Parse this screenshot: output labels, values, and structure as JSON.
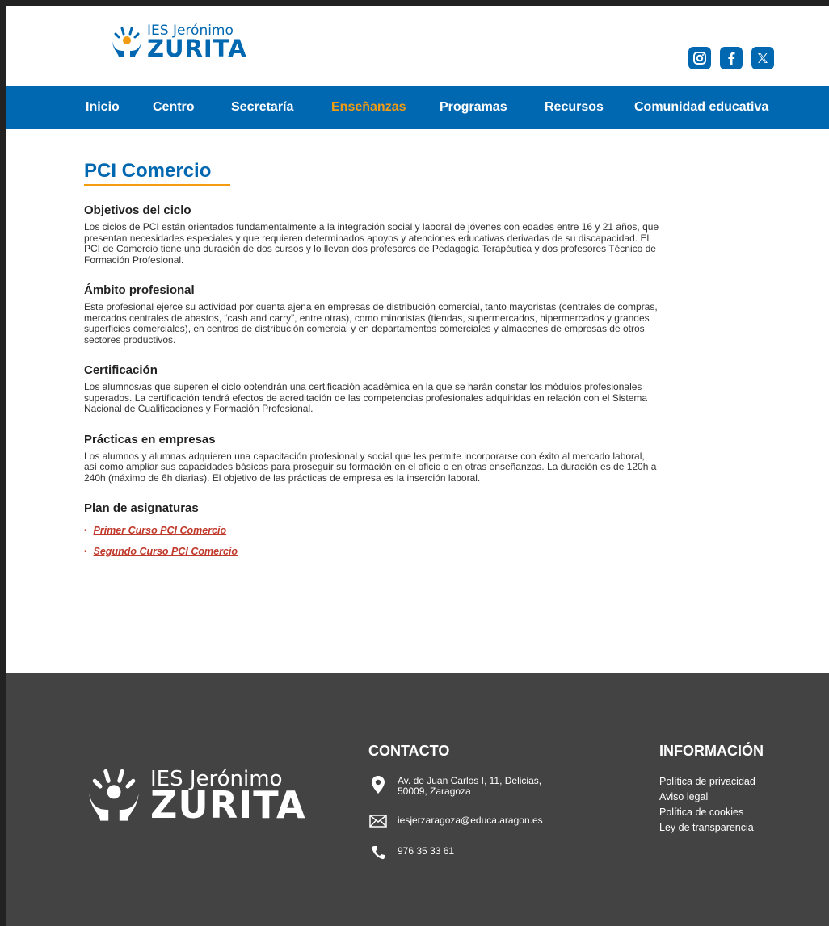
{
  "header": {
    "logo_line1": "IES Jerónimo",
    "logo_line2": "ZURITA",
    "social": [
      {
        "name": "instagram-icon"
      },
      {
        "name": "facebook-icon"
      },
      {
        "name": "x-twitter-icon"
      }
    ]
  },
  "nav": {
    "items": [
      {
        "label": "Inicio",
        "active": false
      },
      {
        "label": "Centro",
        "active": false
      },
      {
        "label": "Secretaría",
        "active": false
      },
      {
        "label": "Enseñanzas",
        "active": true
      },
      {
        "label": "Programas",
        "active": false
      },
      {
        "label": "Recursos",
        "active": false
      },
      {
        "label": "Comunidad educativa",
        "active": false
      }
    ]
  },
  "main": {
    "title": "PCI Comercio",
    "sections": [
      {
        "heading": "Objetivos del ciclo",
        "text": "Los ciclos de PCI están orientados fundamentalmente a la integración social y laboral de jóvenes con edades entre 16 y 21 años, que presentan necesidades especiales y que requieren determinados apoyos y atenciones educativas derivadas de su discapacidad. El PCI de Comercio tiene una duración de dos cursos y lo llevan dos profesores de Pedagogía Terapéutica y dos profesores Técnico de Formación Profesional."
      },
      {
        "heading": "Ámbito profesional",
        "text": "Este profesional ejerce su actividad por cuenta ajena en empresas de distribución comercial, tanto mayoristas (centrales de compras, mercados centrales de abastos, “cash and carry”, entre otras), como minoristas (tiendas, supermercados, hipermercados y grandes superficies comerciales), en centros de distribución comercial y en departamentos comerciales y almacenes de empresas de otros sectores productivos."
      },
      {
        "heading": "Certificación",
        "text": "Los alumnos/as que superen el ciclo obtendrán una certificación académica en la que se harán constar los módulos profesionales superados. La certificación tendrá efectos de acreditación de las competencias profesionales adquiridas en relación con el Sistema Nacional de Cualificaciones y Formación Profesional."
      },
      {
        "heading": "Prácticas en empresas",
        "text": "Los alumnos y alumnas adquieren una capacitación profesional y social que les permite incorporarse con éxito al mercado laboral, así como ampliar sus capacidades básicas para proseguir su formación en el oficio o en otras enseñanzas. La duración es de 120h a 240h (máximo de 6h diarias). El objetivo de las prácticas de empresa es la inserción laboral."
      }
    ],
    "plan_heading": "Plan de asignaturas",
    "plan_links": [
      {
        "label": "Primer Curso PCI Comercio"
      },
      {
        "label": "Segundo Curso PCI Comercio"
      }
    ]
  },
  "footer": {
    "logo_line1": "IES Jerónimo",
    "logo_line2": "ZURITA",
    "contact_title": "CONTACTO",
    "address_line1": "Av. de Juan Carlos I, 11, Delicias,",
    "address_line2": "50009, Zaragoza",
    "email": "iesjerzaragoza@educa.aragon.es",
    "phone": "976 35 33 61",
    "info_title": "INFORMACIÓN",
    "info_links": [
      {
        "label": "Política de privacidad"
      },
      {
        "label": "Aviso legal"
      },
      {
        "label": "Política de cookies"
      },
      {
        "label": "Ley de transparencia"
      }
    ]
  },
  "colors": {
    "brand_blue": "#0067b1",
    "accent_orange": "#f39c12",
    "link_red": "#c0392b",
    "footer_bg": "#434343"
  }
}
